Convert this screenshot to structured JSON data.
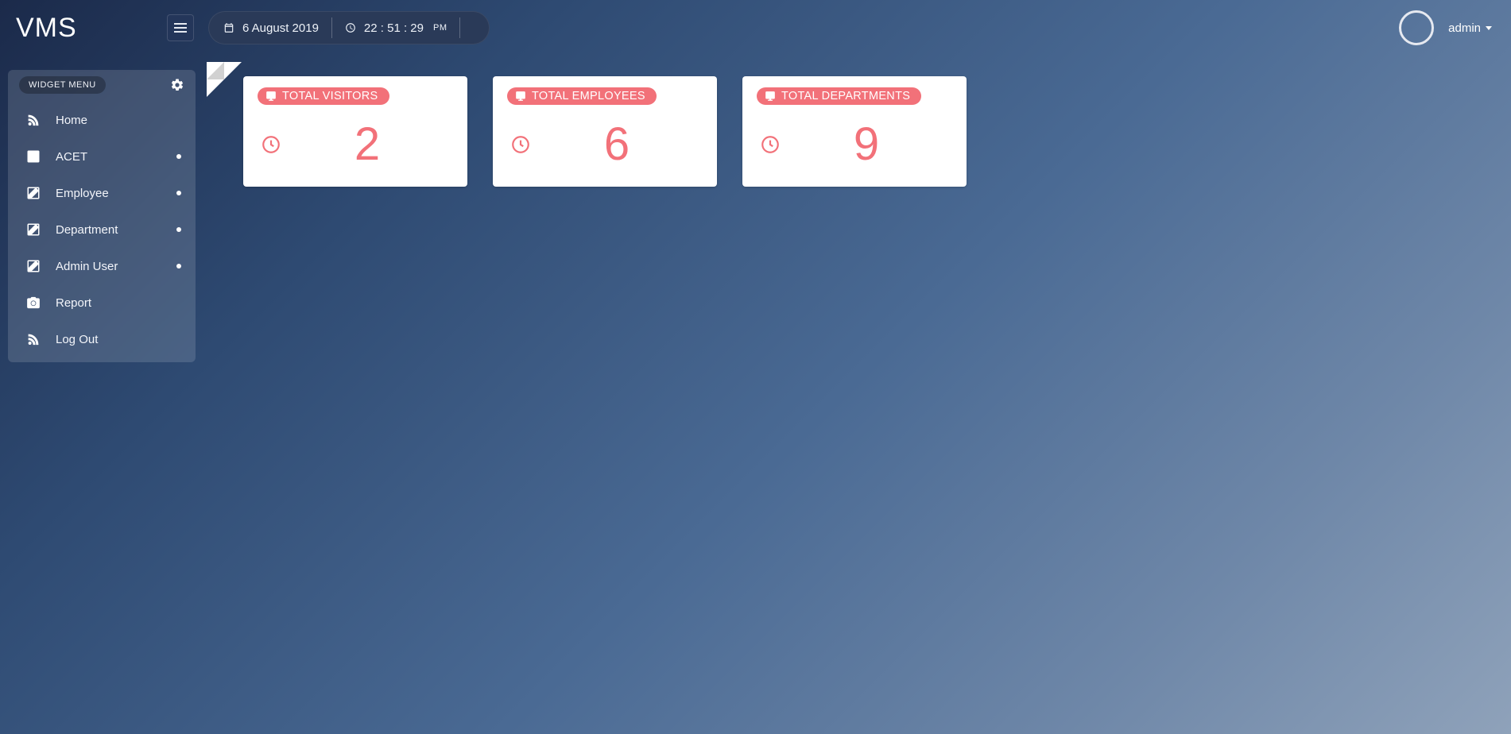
{
  "brand": "VMS",
  "header": {
    "date": "6 August 2019",
    "time": "22 : 51 : 29",
    "time_suffix": "PM",
    "user": "admin"
  },
  "sidebar": {
    "title": "WIDGET MENU",
    "items": [
      {
        "label": "Home",
        "icon": "rss",
        "has_dot": false
      },
      {
        "label": "ACET",
        "icon": "edit",
        "has_dot": true
      },
      {
        "label": "Employee",
        "icon": "edit",
        "has_dot": true
      },
      {
        "label": "Department",
        "icon": "edit",
        "has_dot": true
      },
      {
        "label": "Admin User",
        "icon": "edit",
        "has_dot": true
      },
      {
        "label": "Report",
        "icon": "camera",
        "has_dot": false
      },
      {
        "label": "Log Out",
        "icon": "rss",
        "has_dot": false
      }
    ]
  },
  "cards": [
    {
      "title": "TOTAL VISITORS",
      "value": "2"
    },
    {
      "title": "TOTAL EMPLOYEES",
      "value": "6"
    },
    {
      "title": "TOTAL DEPARTMENTS",
      "value": "9"
    }
  ],
  "colors": {
    "accent": "#f27179"
  }
}
